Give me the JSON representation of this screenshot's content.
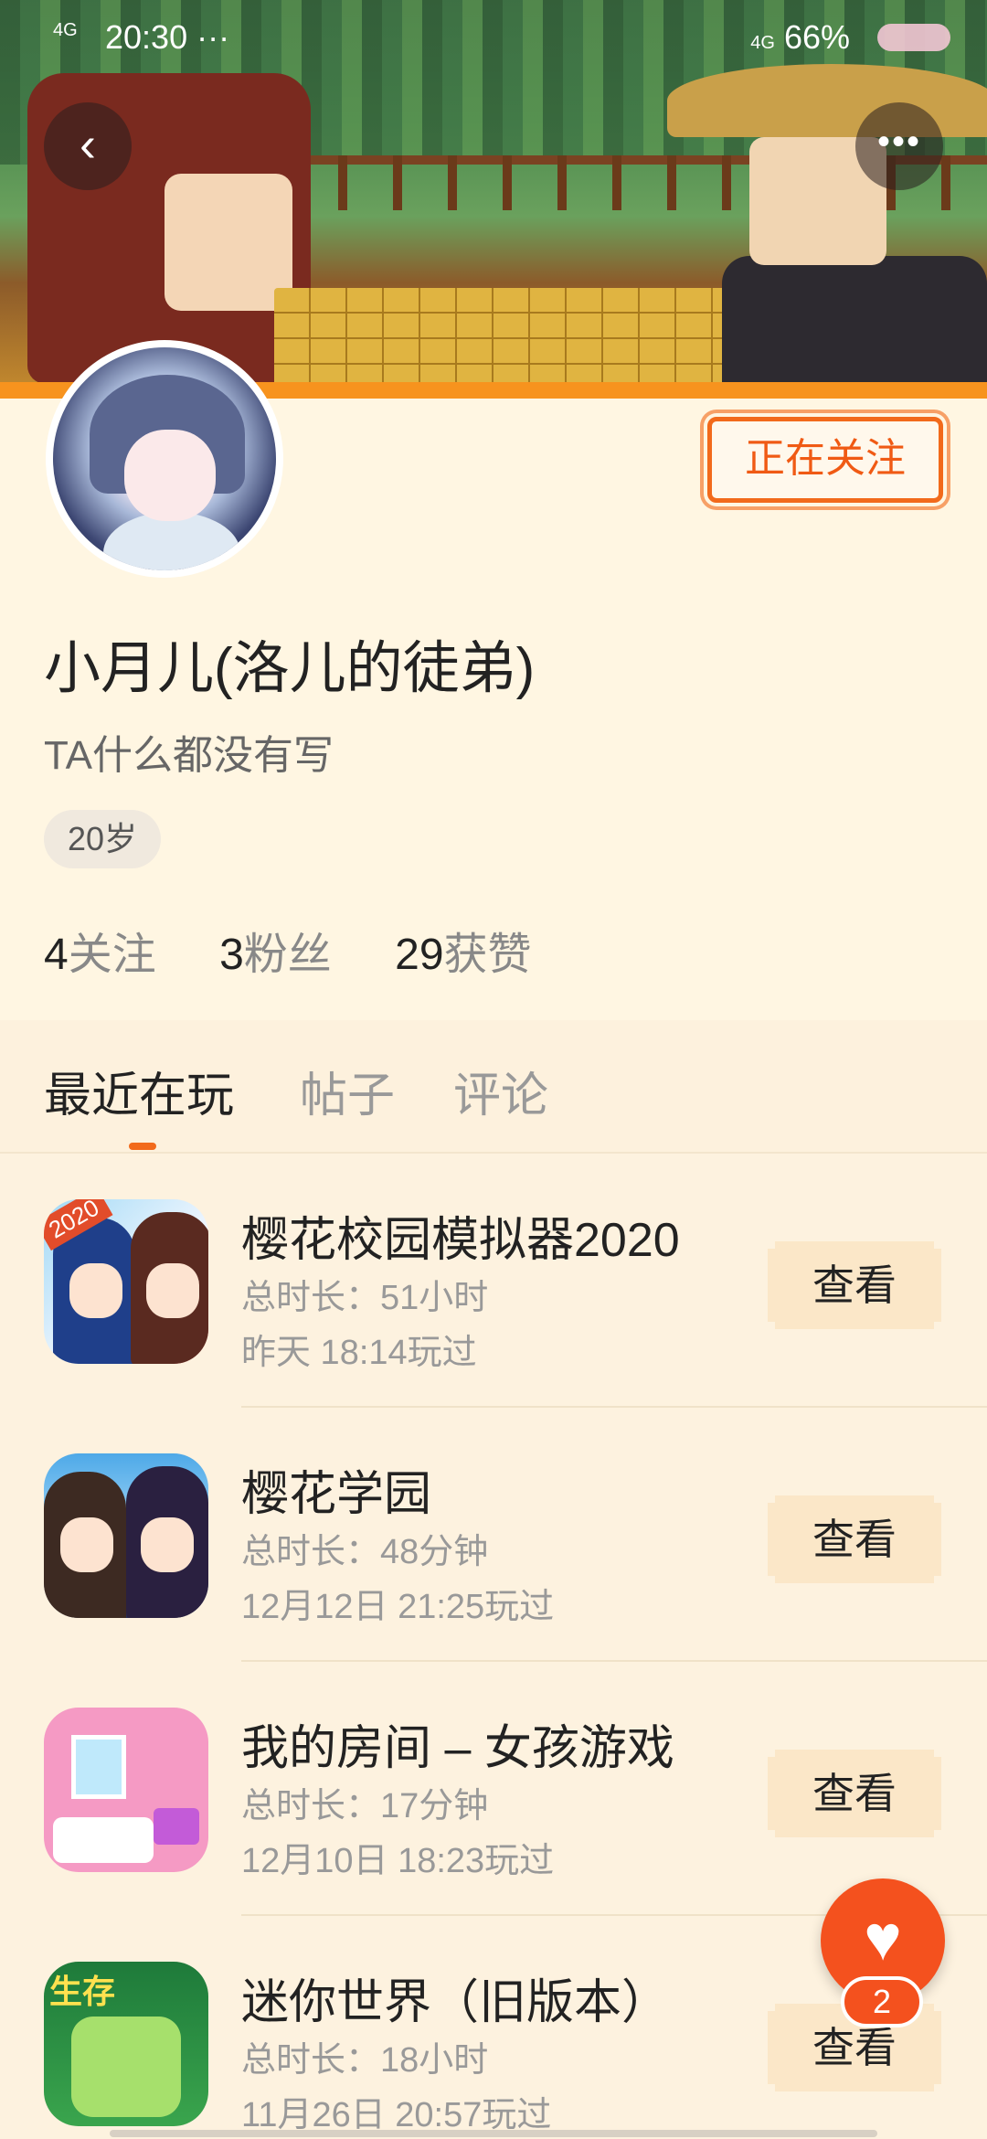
{
  "status_bar": {
    "network_left": "4G",
    "time": "20:30",
    "dots": "···",
    "network_right": "4G",
    "battery": "66%"
  },
  "header": {
    "back_icon": "chevron-left-icon",
    "more_icon": "more-horizontal-icon"
  },
  "profile": {
    "follow_label": "正在关注",
    "nickname": "小月儿(洛儿的徒弟)",
    "bio": "TA什么都没有写",
    "age": "20岁",
    "stats": [
      {
        "num": "4",
        "label": "关注"
      },
      {
        "num": "3",
        "label": "粉丝"
      },
      {
        "num": "29",
        "label": "获赞"
      }
    ]
  },
  "tabs": [
    {
      "label": "最近在玩",
      "active": true
    },
    {
      "label": "帖子",
      "active": false
    },
    {
      "label": "评论",
      "active": false
    }
  ],
  "games": [
    {
      "title": "樱花校园模拟器2020",
      "duration": "总时长：51小时",
      "last_played": "昨天 18:14玩过",
      "button": "查看",
      "icon_tag": "2020"
    },
    {
      "title": "樱花学园",
      "duration": "总时长：48分钟",
      "last_played": "12月12日 21:25玩过",
      "button": "查看"
    },
    {
      "title": "我的房间 – 女孩游戏",
      "duration": "总时长：17分钟",
      "last_played": "12月10日 18:23玩过",
      "button": "查看"
    },
    {
      "title": "迷你世界（旧版本）",
      "duration": "总时长：18小时",
      "last_played": "11月26日 20:57玩过",
      "button": "查看",
      "icon_tag": "生存"
    }
  ],
  "fab": {
    "icon": "heart-icon",
    "count": "2"
  },
  "colors": {
    "accent": "#f26a1b",
    "background": "#fdf2df"
  }
}
